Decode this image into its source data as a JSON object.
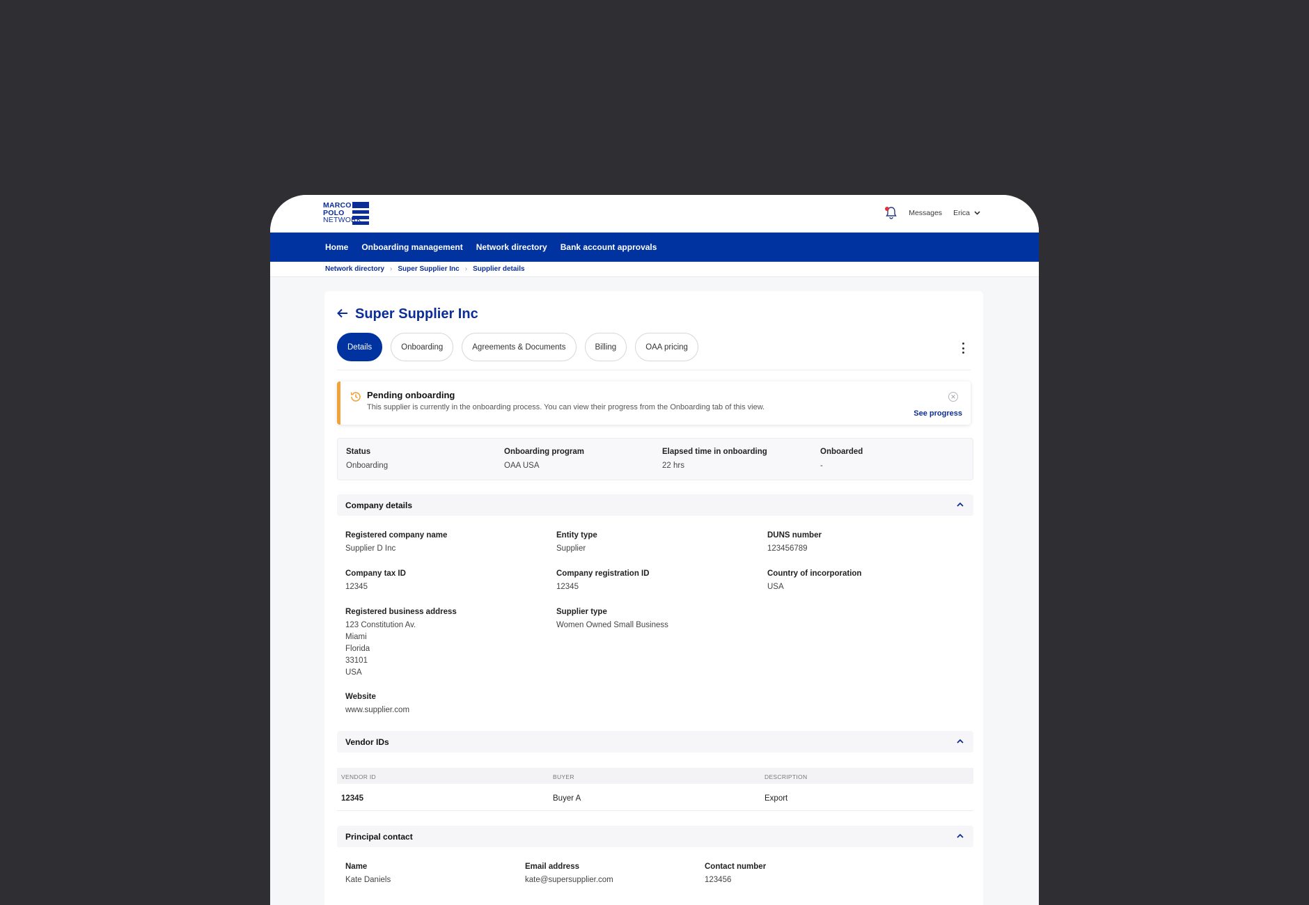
{
  "brand": {
    "line1": "MARCO",
    "line2": "POLO",
    "line3": "NETWORK",
    "color": "#0033a0"
  },
  "header": {
    "messages": "Messages",
    "user": "Erica"
  },
  "nav": [
    "Home",
    "Onboarding management",
    "Network directory",
    "Bank account approvals"
  ],
  "breadcrumb": [
    "Network directory",
    "Super Supplier Inc",
    "Supplier details"
  ],
  "page": {
    "title": "Super Supplier Inc"
  },
  "tabs": [
    "Details",
    "Onboarding",
    "Agreements & Documents",
    "Billing",
    "OAA pricing"
  ],
  "alert": {
    "title": "Pending onboarding",
    "body": "This supplier is currently in the onboarding process. You can view their progress from the Onboarding tab of this view.",
    "link": "See progress",
    "accent": "#f2a23a"
  },
  "status": [
    {
      "label": "Status",
      "value": "Onboarding"
    },
    {
      "label": "Onboarding program",
      "value": "OAA USA"
    },
    {
      "label": "Elapsed time in onboarding",
      "value": "22 hrs"
    },
    {
      "label": "Onboarded",
      "value": "-"
    }
  ],
  "company": {
    "heading": "Company details",
    "registered_name": {
      "label": "Registered company name",
      "value": "Supplier D Inc"
    },
    "entity_type": {
      "label": "Entity type",
      "value": "Supplier"
    },
    "duns": {
      "label": "DUNS number",
      "value": "123456789"
    },
    "tax_id": {
      "label": "Company tax ID",
      "value": "12345"
    },
    "registration_id": {
      "label": "Company registration ID",
      "value": "12345"
    },
    "country": {
      "label": "Country of incorporation",
      "value": "USA"
    },
    "address": {
      "label": "Registered business address",
      "lines": [
        "123 Constitution Av.",
        "Miami",
        "Florida",
        "33101",
        "USA"
      ]
    },
    "supplier_type": {
      "label": "Supplier type",
      "value": "Women Owned Small Business"
    },
    "website": {
      "label": "Website",
      "value": "www.supplier.com"
    }
  },
  "vendor": {
    "heading": "Vendor IDs",
    "columns": [
      "VENDOR ID",
      "BUYER",
      "DESCRIPTION"
    ],
    "rows": [
      [
        "12345",
        "Buyer A",
        "Export"
      ]
    ]
  },
  "contact": {
    "heading": "Principal contact",
    "name": {
      "label": "Name",
      "value": "Kate Daniels"
    },
    "email": {
      "label": "Email address",
      "value": "kate@supersupplier.com"
    },
    "phone": {
      "label": "Contact number",
      "value": "123456"
    }
  }
}
